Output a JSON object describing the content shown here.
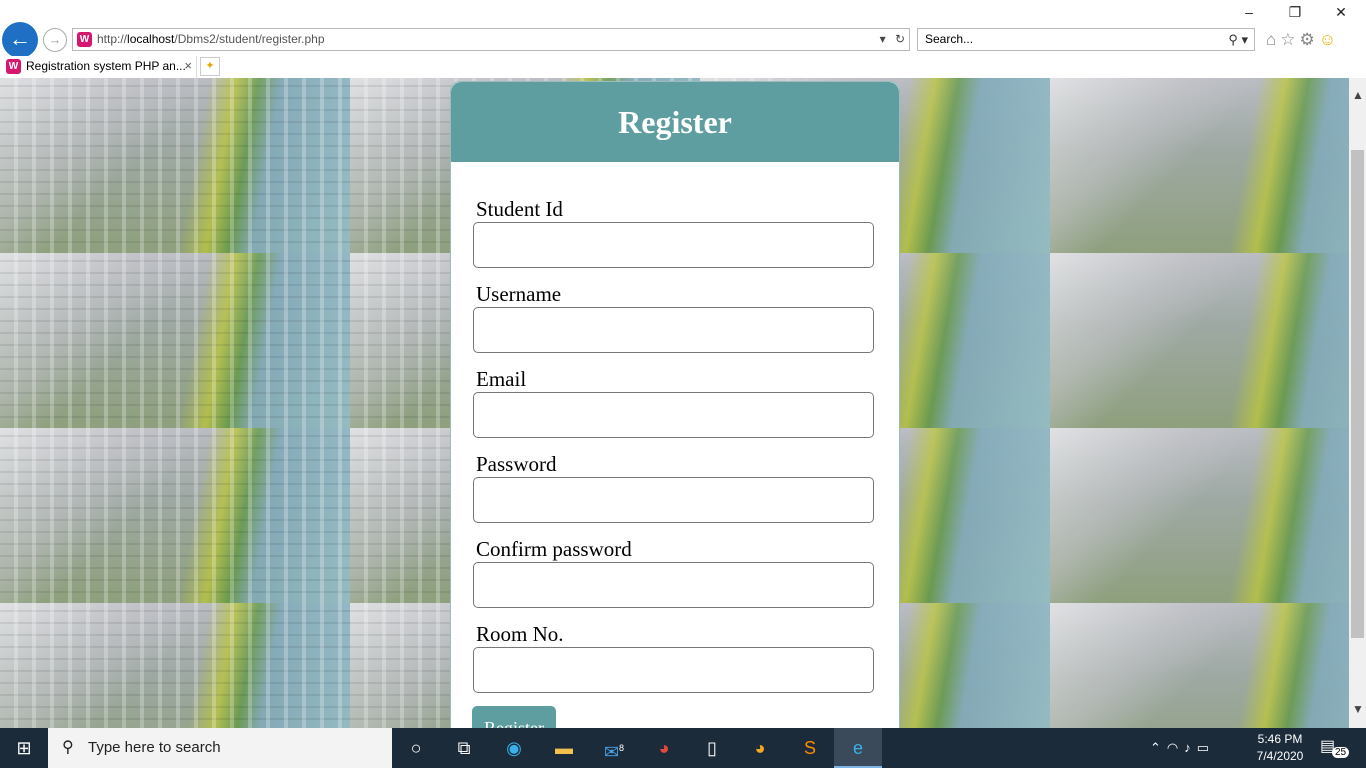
{
  "browser": {
    "window_controls": {
      "minimize": "–",
      "restore": "❐",
      "close": "✕"
    },
    "address": {
      "scheme": "http://",
      "host": "localhost",
      "path": "/Dbms2/student/register.php"
    },
    "search_placeholder": "Search...",
    "tab": {
      "title": "Registration system PHP an...",
      "close": "×"
    }
  },
  "form": {
    "title": "Register",
    "fields": [
      {
        "label": "Student Id"
      },
      {
        "label": "Username"
      },
      {
        "label": "Email"
      },
      {
        "label": "Password"
      },
      {
        "label": "Confirm password"
      },
      {
        "label": "Room No."
      }
    ],
    "submit_label": "Register"
  },
  "taskbar": {
    "search_placeholder": "Type here to search",
    "mail_badge": "8",
    "time": "5:46 PM",
    "date": "7/4/2020",
    "notification_count": "25"
  },
  "colors": {
    "accent": "#5f9ea0",
    "taskbar": "#1c2b3a",
    "ie_blue": "#1f6fc5"
  }
}
